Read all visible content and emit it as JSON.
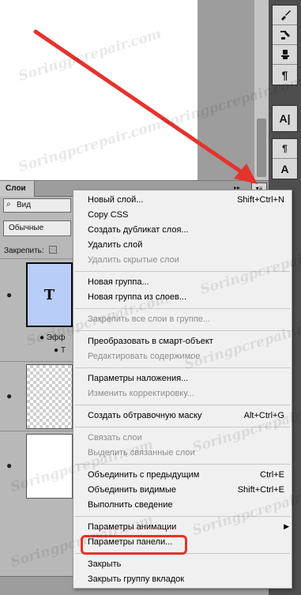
{
  "colors": {
    "accent_arrow": "#e4332d",
    "menu_bg": "#f0f0f0",
    "layer_thumb_blue": "#b8cdf7"
  },
  "toolbar": {
    "icons": [
      "brush-icon",
      "brush-presets-icon",
      "clone-source-icon",
      "paragraph-icon",
      "character-icon",
      "paragraph-styles-icon",
      "character-styles-icon"
    ],
    "paragraph_glyph": "¶",
    "character_glyph": "A|",
    "character_styles_glyph": "A"
  },
  "layers_panel": {
    "tab_label": "Слои",
    "collapse_glyph": "▸▸",
    "menu_glyph": "▾≡",
    "search_label": "Вид",
    "blend_mode": "Обычные",
    "lock_label": "Закрепить:",
    "text_thumb_glyph": "T",
    "effects_label": "Эфф",
    "effect_sub_label": "Т"
  },
  "context_menu": {
    "new_layer": {
      "label": "Новый слой...",
      "shortcut": "Shift+Ctrl+N"
    },
    "copy_css": "Copy CSS",
    "duplicate_layer": "Создать дубликат слоя...",
    "delete_layer": "Удалить слой",
    "delete_hidden": "Удалить скрытые слои",
    "new_group": "Новая группа...",
    "new_group_from_layers": "Новая группа из слоев...",
    "lock_all_in_group": "Закрепить все слои в группе...",
    "convert_smart_object": "Преобразовать в смарт-объект",
    "edit_contents": "Редактировать содержимое",
    "blending_options": "Параметры наложения...",
    "edit_adjustment": "Изменить корректировку...",
    "clipping_mask": {
      "label": "Создать обтравочную маску",
      "shortcut": "Alt+Ctrl+G"
    },
    "link_layers": "Связать слои",
    "select_linked": "Выделить связанные слои",
    "merge_down": {
      "label": "Объединить с предыдущим",
      "shortcut": "Ctrl+E"
    },
    "merge_visible": {
      "label": "Объединить видимые",
      "shortcut": "Shift+Ctrl+E"
    },
    "flatten": "Выполнить сведение",
    "animation_options": "Параметры анимации",
    "panel_options": "Параметры панели...",
    "close": "Закрыть",
    "close_tab_group": "Закрыть группу вкладок"
  },
  "watermark": "Soringpcrepair.com"
}
